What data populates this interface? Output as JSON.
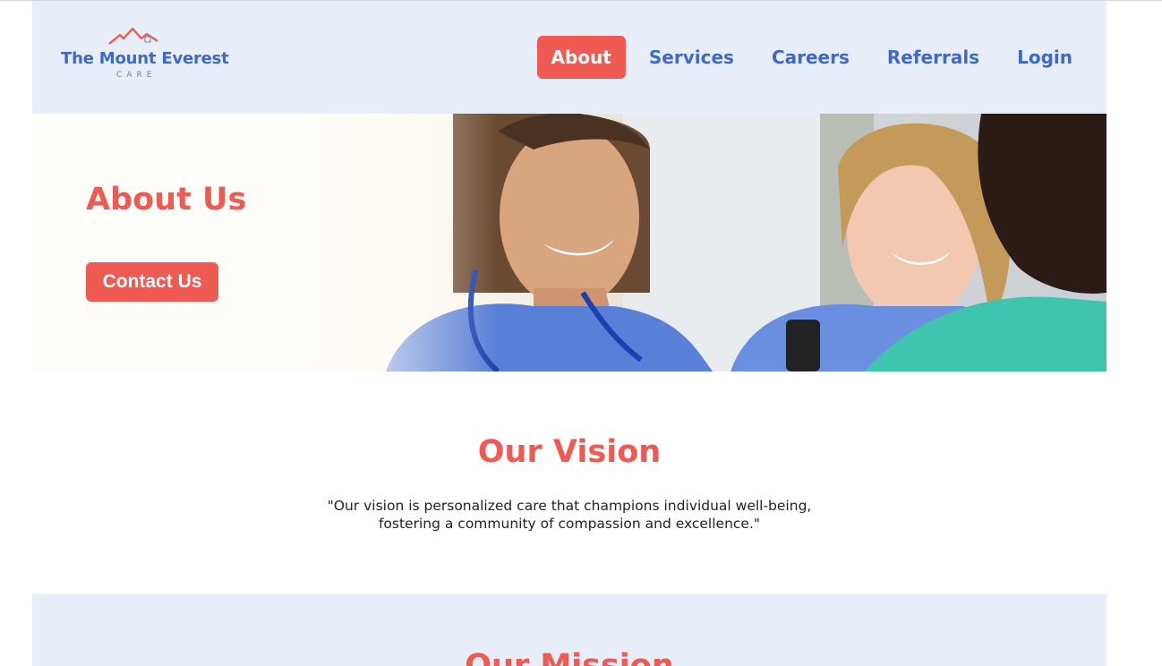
{
  "brand": {
    "name": "The  Mount Everest",
    "sub": "CARE",
    "primary_color": "#3f69c8",
    "accent_color": "#ef5a53",
    "header_bg": "#e8eef7"
  },
  "nav": {
    "items": [
      {
        "label": "About",
        "active": true
      },
      {
        "label": "Services",
        "active": false
      },
      {
        "label": "Careers",
        "active": false
      },
      {
        "label": "Referrals",
        "active": false
      },
      {
        "label": "Login",
        "active": false
      }
    ]
  },
  "hero": {
    "title": "About Us",
    "button_label": "Contact Us",
    "image_desc_icon": "nurses-photo"
  },
  "vision": {
    "title": "Our Vision",
    "text_line1": "\"Our vision is personalized care that champions individual well-being,",
    "text_line2": "fostering a community of compassion and excellence.\""
  },
  "mission": {
    "title": "Our Mission"
  }
}
